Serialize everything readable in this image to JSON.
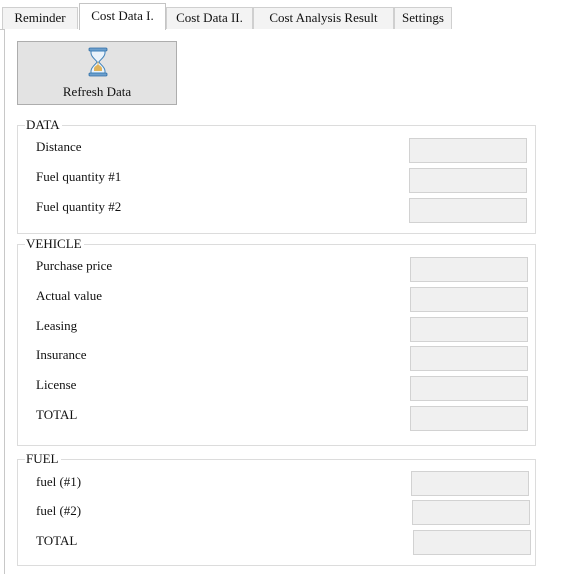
{
  "tabs": [
    {
      "label": "Reminder",
      "active": false
    },
    {
      "label": "Cost Data I.",
      "active": true
    },
    {
      "label": "Cost Data II.",
      "active": false
    },
    {
      "label": "Cost Analysis Result",
      "active": false
    },
    {
      "label": "Settings",
      "active": false
    }
  ],
  "refresh_button": {
    "label": "Refresh Data",
    "icon": "hourglass-icon"
  },
  "groups": {
    "data": {
      "title": "DATA",
      "fields": [
        {
          "label": "Distance",
          "value": ""
        },
        {
          "label": "Fuel quantity #1",
          "value": ""
        },
        {
          "label": "Fuel quantity #2",
          "value": ""
        }
      ]
    },
    "vehicle": {
      "title": "VEHICLE",
      "fields": [
        {
          "label": "Purchase price",
          "value": ""
        },
        {
          "label": "Actual value",
          "value": ""
        },
        {
          "label": "Leasing",
          "value": ""
        },
        {
          "label": "Insurance",
          "value": ""
        },
        {
          "label": "License",
          "value": ""
        },
        {
          "label": "TOTAL",
          "value": ""
        }
      ]
    },
    "fuel": {
      "title": "FUEL",
      "fields": [
        {
          "label": "fuel (#1)",
          "value": ""
        },
        {
          "label": "fuel (#2)",
          "value": ""
        },
        {
          "label": "TOTAL",
          "value": ""
        }
      ]
    }
  },
  "colors": {
    "panel_border": "#c8c8c8",
    "field_background": "#f0f0f0",
    "button_background": "#e3e3e3",
    "hourglass_accent": "#3c7fb8"
  }
}
